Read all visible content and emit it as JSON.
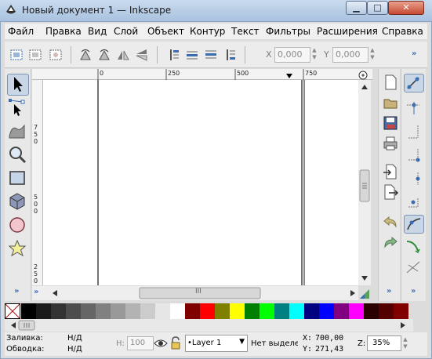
{
  "window": {
    "title": "Новый документ 1 — Inkscape",
    "controls": {
      "minimize": "▁",
      "maximize": "□",
      "close": "✕"
    }
  },
  "menubar": {
    "items": [
      {
        "label": "Файл"
      },
      {
        "label": "Правка"
      },
      {
        "label": "Вид"
      },
      {
        "label": "Слой"
      },
      {
        "label": "Объект"
      },
      {
        "label": "Контур"
      },
      {
        "label": "Текст"
      },
      {
        "label": "Фильтры"
      },
      {
        "label": "Расширения"
      },
      {
        "label": "Справка"
      }
    ]
  },
  "toolbar": {
    "x_label": "X",
    "x_value": "0,000",
    "y_label": "Y",
    "y_value": "0,000",
    "more": "»"
  },
  "rulers": {
    "top_ticks": [
      "0",
      "250",
      "500",
      "750"
    ],
    "left_ticks": [
      "750",
      "500",
      "250"
    ]
  },
  "scrollbars": {
    "grip": "III"
  },
  "leftpanel": {
    "more": "»"
  },
  "cmdbar": {
    "more": "»"
  },
  "snapbar": {
    "more": "»"
  },
  "palette": {
    "colors": [
      "#000000",
      "#1a1a1a",
      "#333333",
      "#4d4d4d",
      "#666666",
      "#808080",
      "#999999",
      "#b3b3b3",
      "#cccccc",
      "#e6e6e6",
      "#ffffff",
      "#800000",
      "#ff0000",
      "#808000",
      "#ffff00",
      "#008000",
      "#00ff00",
      "#008080",
      "#00ffff",
      "#000080",
      "#0000ff",
      "#800080",
      "#ff00ff",
      "#2b0000",
      "#550000",
      "#800000"
    ]
  },
  "statusbar": {
    "fill_label": "Заливка:",
    "fill_value": "Н/Д",
    "stroke_label": "Обводка:",
    "stroke_value": "Н/Д",
    "opacity_label": "Н:",
    "opacity_value": "100",
    "layer": "•Layer 1",
    "message": "Нет выделе",
    "x_label": "X:",
    "x_value": "700,00",
    "y_label": "Y:",
    "y_value": "271,43",
    "zoom_label": "Z:",
    "zoom_value": "35%"
  },
  "colors": {
    "accent": "#3a6db0",
    "title_gradient_top": "#c9dbee",
    "close_red": "#c74a33"
  }
}
